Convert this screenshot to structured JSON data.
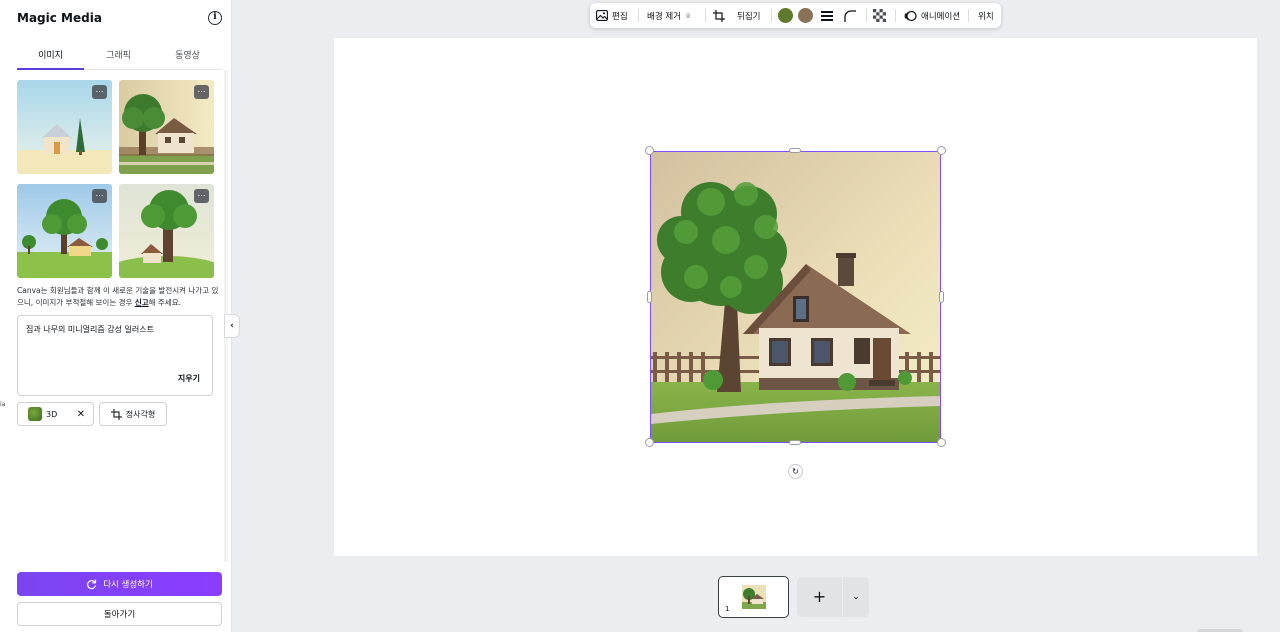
{
  "panel": {
    "title": "Magic Media",
    "tabs": [
      {
        "label": "이미지"
      },
      {
        "label": "그래픽"
      },
      {
        "label": "동영상"
      }
    ],
    "more_icon": "…",
    "disclaimer_pre": "Canva는 회원님들과 함께 이 새로운 기술을 발전시켜 나가고 있으니, 이미지가 부적절해 보이는 경우 ",
    "disclaimer_link": "신고",
    "disclaimer_post": "해 주세요.",
    "prompt_text": "집과 나무의 미니멀리즘 감성 일러스트",
    "clear_label": "지우기",
    "style_chip_label": "3D",
    "ratio_chip_label": "정사각형",
    "regenerate_label": "다시 생성하기",
    "back_label": "돌아가기",
    "side_fragment": "ia"
  },
  "toolbar": {
    "edit_label": "편집",
    "remove_bg_label": "배경 제거",
    "flip_label": "뒤집기",
    "colors": [
      "#5f7a2c",
      "#8a7259"
    ],
    "animate_label": "애니메이션",
    "position_label": "위치"
  },
  "pages": {
    "current_page": "1",
    "add_label": "+"
  }
}
